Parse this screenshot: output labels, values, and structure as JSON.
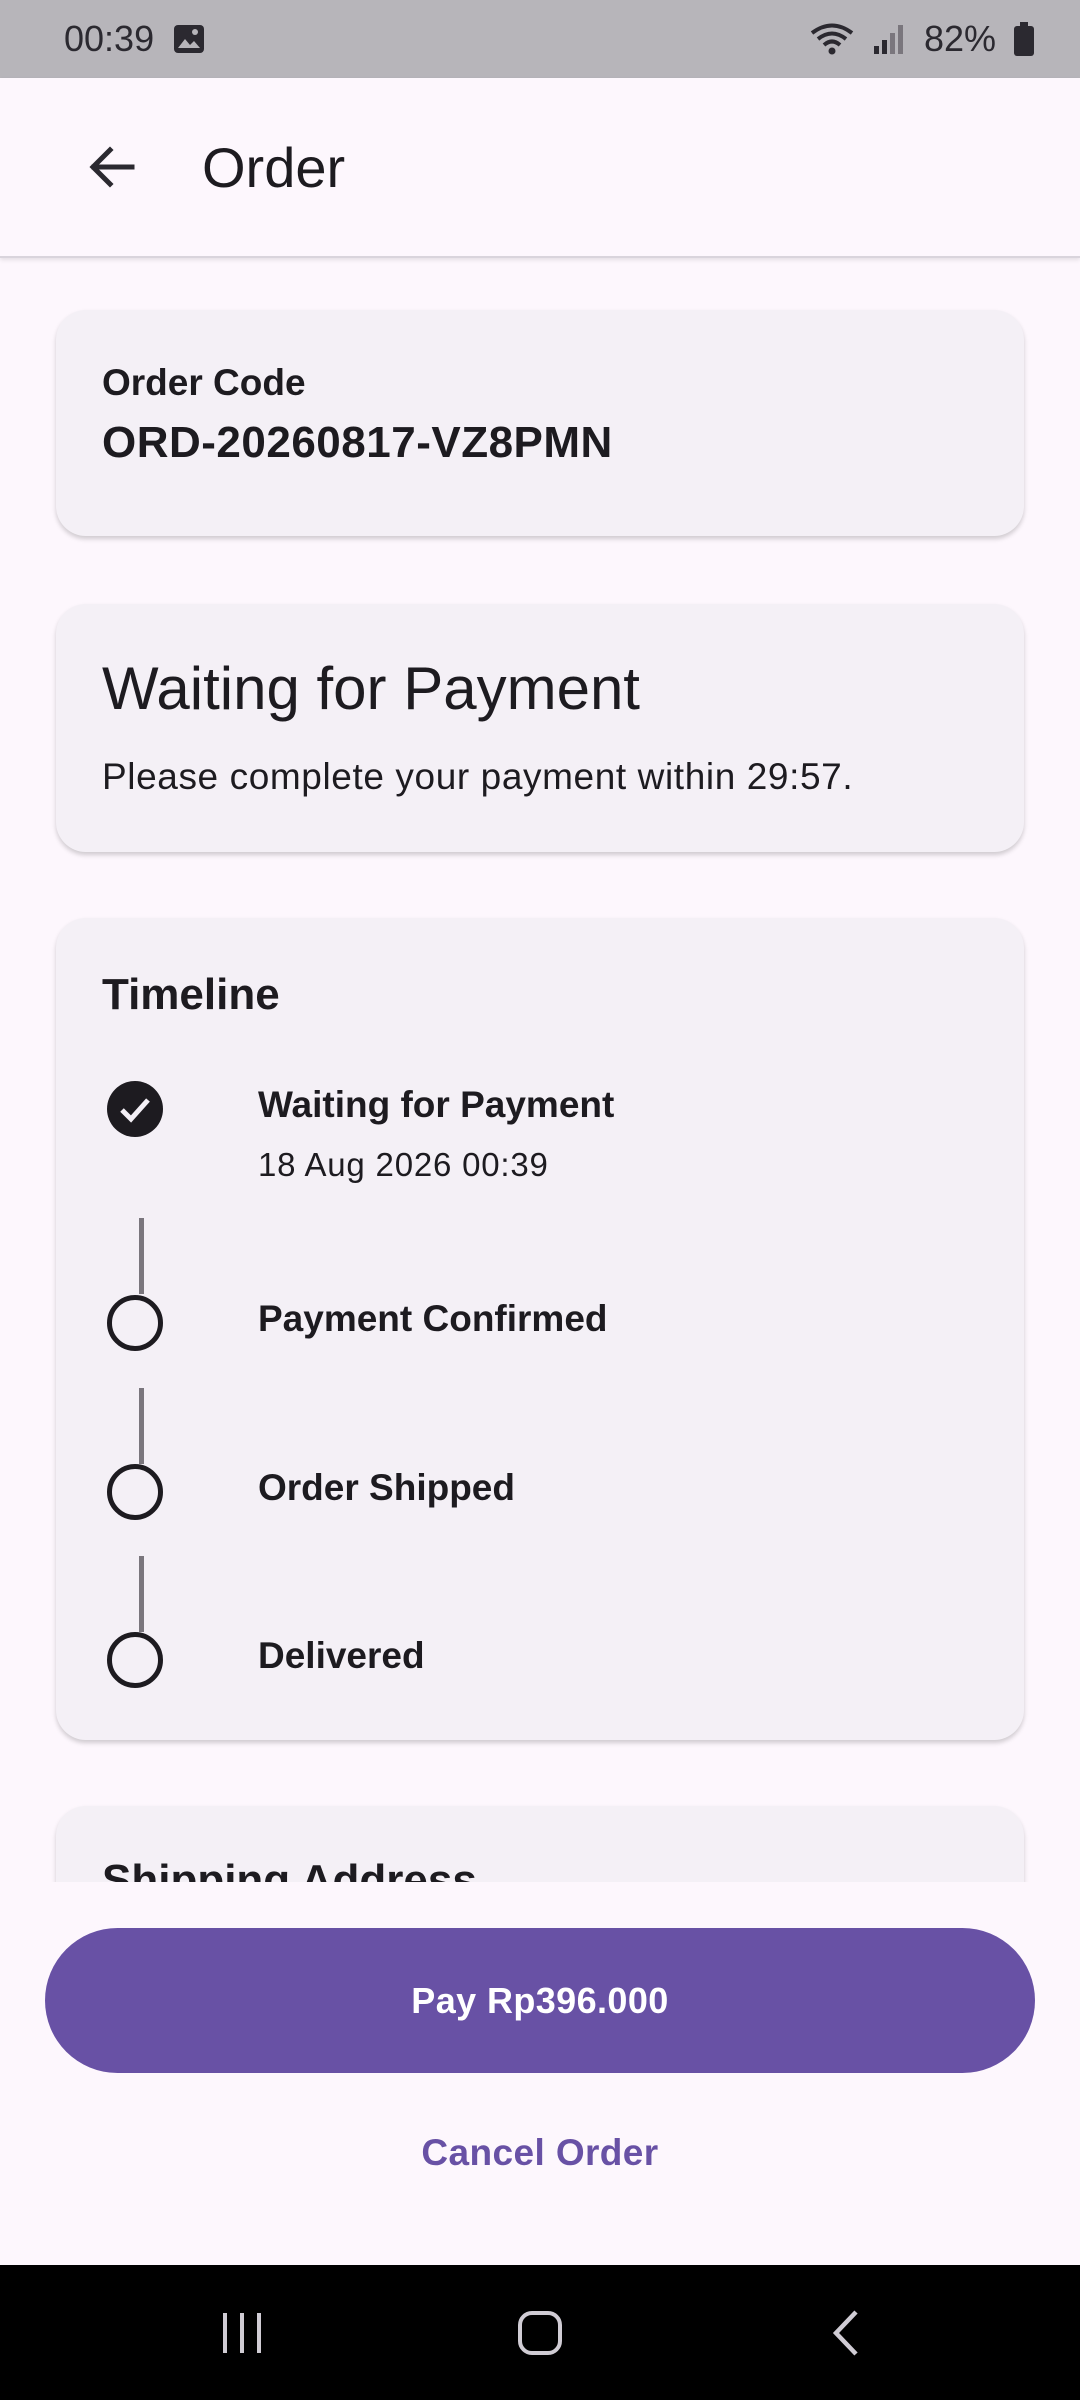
{
  "status_bar": {
    "time": "00:39",
    "battery": "82%"
  },
  "app_bar": {
    "title": "Order"
  },
  "order_code": {
    "label": "Order Code",
    "value": "ORD-20260817-VZ8PMN"
  },
  "order_status": {
    "title": "Waiting for Payment",
    "description": "Please complete your payment within 29:57."
  },
  "timeline": {
    "title": "Timeline",
    "steps": [
      {
        "label": "Waiting for Payment",
        "date": "18 Aug 2026 00:39",
        "completed": true
      },
      {
        "label": "Payment Confirmed",
        "completed": false
      },
      {
        "label": "Order Shipped",
        "completed": false
      },
      {
        "label": "Delivered",
        "completed": false
      }
    ]
  },
  "shipping": {
    "title": "Shipping Address"
  },
  "actions": {
    "pay": "Pay Rp396.000",
    "cancel": "Cancel Order"
  },
  "colors": {
    "primary": "#6851a5",
    "background": "#fdf7fd",
    "card": "#f4f0f6"
  }
}
